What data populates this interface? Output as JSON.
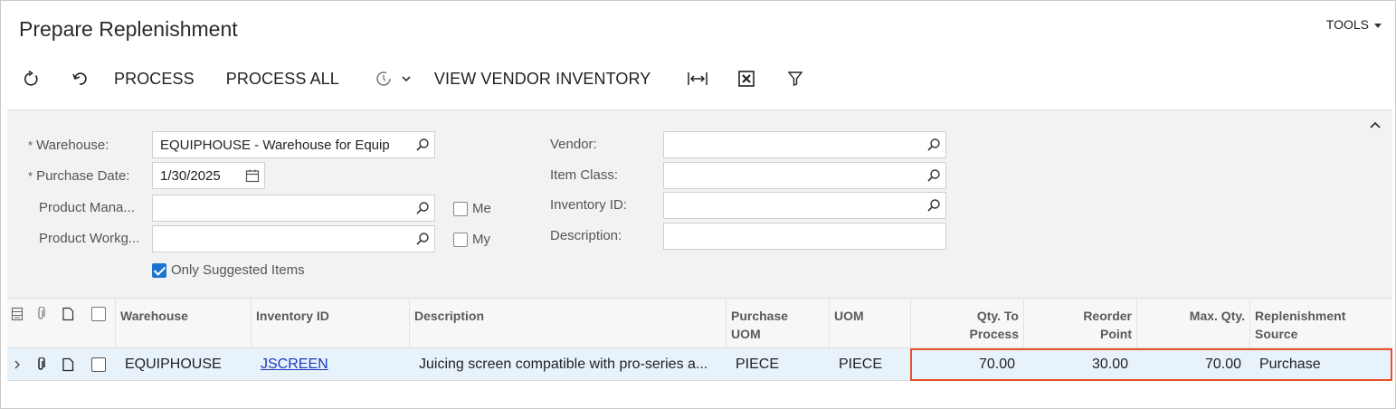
{
  "header": {
    "title": "Prepare Replenishment",
    "tools_label": "TOOLS"
  },
  "toolbar": {
    "refresh_icon": "refresh-icon",
    "undo_icon": "undo-icon",
    "process_label": "PROCESS",
    "process_all_label": "PROCESS ALL",
    "schedule_icon": "schedule-icon",
    "view_vendor_inventory_label": "VIEW VENDOR INVENTORY",
    "fit_width_icon": "fit-width-icon",
    "excel_icon": "excel-export-icon",
    "filter_icon": "filter-icon"
  },
  "filters": {
    "warehouse_label": "Warehouse:",
    "warehouse_value": "EQUIPHOUSE - Warehouse for Equip",
    "purchase_date_label": "Purchase Date:",
    "purchase_date_value": "1/30/2025",
    "product_manager_label": "Product Mana...",
    "product_manager_value": "",
    "product_workgroup_label": "Product Workg...",
    "product_workgroup_value": "",
    "me_label": "Me",
    "me_checked": false,
    "my_label": "My",
    "my_checked": false,
    "only_suggested_label": "Only Suggested Items",
    "only_suggested_checked": true,
    "vendor_label": "Vendor:",
    "vendor_value": "",
    "item_class_label": "Item Class:",
    "item_class_value": "",
    "inventory_id_label": "Inventory ID:",
    "inventory_id_value": "",
    "description_label": "Description:",
    "description_value": ""
  },
  "grid": {
    "columns": {
      "warehouse": "Warehouse",
      "inventory_id": "Inventory ID",
      "description": "Description",
      "purchase_uom_1": "Purchase",
      "purchase_uom_2": "UOM",
      "uom": "UOM",
      "qty_to_process_1": "Qty. To",
      "qty_to_process_2": "Process",
      "reorder_point_1": "Reorder",
      "reorder_point_2": "Point",
      "max_qty": "Max. Qty.",
      "replenishment_source_1": "Replenishment",
      "replenishment_source_2": "Source"
    },
    "rows": [
      {
        "warehouse": "EQUIPHOUSE",
        "inventory_id": "JSCREEN",
        "description": "Juicing screen compatible with pro-series a...",
        "purchase_uom": "PIECE",
        "uom": "PIECE",
        "qty_to_process": "70.00",
        "reorder_point": "30.00",
        "max_qty": "70.00",
        "replenishment_source": "Purchase"
      }
    ]
  },
  "colors": {
    "highlight_border": "#e8512b",
    "selected_row": "#e8f2fb",
    "checkbox_accent": "#1b74d0",
    "link": "#1a3bbf"
  }
}
